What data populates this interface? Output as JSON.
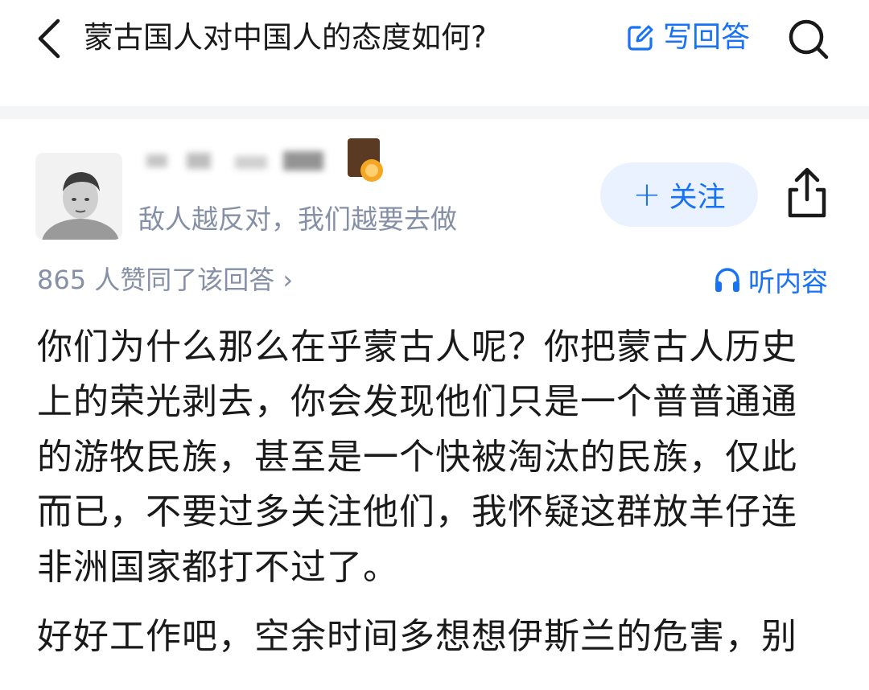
{
  "header": {
    "question_title": "蒙古国人对中国人的态度如何?",
    "write_answer_label": "写回答"
  },
  "author": {
    "bio": "敌人越反对，我们越要去做",
    "follow_label": "关注"
  },
  "meta": {
    "vote_summary": "865 人赞同了该回答 ›",
    "listen_label": "听内容"
  },
  "answer": {
    "paragraphs": [
      "你们为什么那么在乎蒙古人呢？你把蒙古人历史上的荣光剥去，你会发现他们只是一个普普通通的游牧民族，甚至是一个快被淘汰的民族，仅此而已，不要过多关注他们，我怀疑这群放羊仔连非洲国家都打不过了。",
      "好好工作吧，空余时间多想想伊斯兰的危害，别"
    ]
  },
  "colors": {
    "accent": "#1772f6",
    "accent_bg": "#eaf2ff",
    "muted_text": "#8590a6",
    "body_text": "#1a1a1a",
    "divider": "#f4f5f7"
  },
  "icons": {
    "back": "chevron-left-icon",
    "edit": "edit-square-icon",
    "search": "search-icon",
    "share": "share-icon",
    "listen": "headphone-icon",
    "badge": "badge-icon"
  }
}
